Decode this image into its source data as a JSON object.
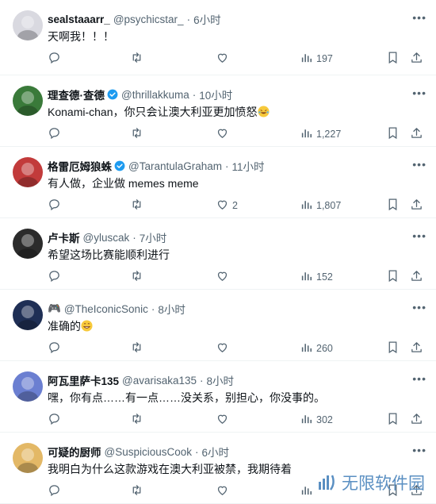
{
  "tweets": [
    {
      "name": "sealstaaarr_",
      "handle": "@psychicstar_",
      "time": "6小时",
      "text": "天啊我！！！",
      "verified": false,
      "likes": "",
      "views": "197",
      "avatar_color": "#d9d9e0"
    },
    {
      "name": "理查德·查德",
      "handle": "@thrillakkuma",
      "time": "10小时",
      "text": "Konami-chan，你只会让澳大利亚更加愤怒",
      "emoji": "joy",
      "verified": true,
      "likes": "",
      "views": "1,227",
      "avatar_color": "#3a7a3a"
    },
    {
      "name": "格雷厄姆狼蛛",
      "handle": "@TarantulaGraham",
      "time": "11小时",
      "text": "有人做，企业做 memes meme",
      "verified": true,
      "likes": "2",
      "views": "1,807",
      "avatar_color": "#c23b3b"
    },
    {
      "name": "卢卡斯",
      "handle": "@yluscak",
      "time": "7小时",
      "text": "希望这场比赛能顺利进行",
      "verified": false,
      "likes": "",
      "views": "152",
      "avatar_color": "#2b2b2b"
    },
    {
      "name": "🎮",
      "handle": "@TheIconicSonic",
      "time": "8小时",
      "text": "准确的",
      "emoji": "grin",
      "verified": false,
      "likes": "",
      "views": "260",
      "avatar_color": "#1f2f55"
    },
    {
      "name": "阿瓦里萨卡135",
      "handle": "@avarisaka135",
      "time": "8小时",
      "text": "嘿，你有点……有一点……没关系，别担心，你没事的。",
      "verified": false,
      "likes": "",
      "views": "302",
      "avatar_color": "#6b7fd1"
    },
    {
      "name": "可疑的厨师",
      "handle": "@SuspiciousCook",
      "time": "6小时",
      "text": "我明白为什么这款游戏在澳大利亚被禁，我期待着",
      "verified": false,
      "likes": "",
      "views": "",
      "avatar_color": "#e3b866"
    }
  ],
  "watermark": {
    "text": "无限软件园"
  },
  "colors": {
    "verified": "#1d9bf0",
    "muted": "#536471"
  }
}
